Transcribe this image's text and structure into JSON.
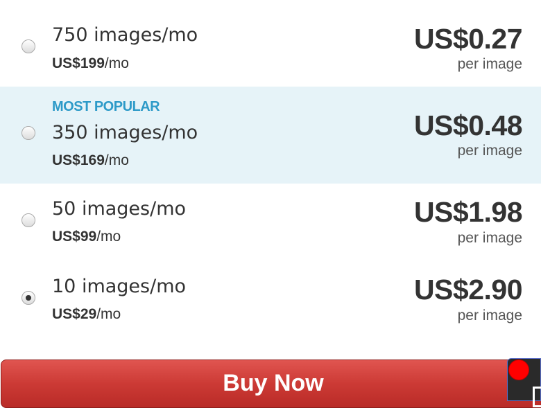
{
  "plans": [
    {
      "quantity": "750 images/mo",
      "monthly_price": "US$199",
      "monthly_suffix": "/mo",
      "unit_price": "US$0.27",
      "per_label": "per image",
      "selected": false
    },
    {
      "badge": "MOST POPULAR",
      "quantity": "350 images/mo",
      "monthly_price": "US$169",
      "monthly_suffix": "/mo",
      "unit_price": "US$0.48",
      "per_label": "per image",
      "selected": false
    },
    {
      "quantity": "50 images/mo",
      "monthly_price": "US$99",
      "monthly_suffix": "/mo",
      "unit_price": "US$1.98",
      "per_label": "per image",
      "selected": false
    },
    {
      "quantity": "10 images/mo",
      "monthly_price": "US$29",
      "monthly_suffix": "/mo",
      "unit_price": "US$2.90",
      "per_label": "per image",
      "selected": true
    }
  ],
  "buy_button": {
    "label": "Buy Now"
  },
  "colors": {
    "highlight_bg": "#e6f3f8",
    "badge": "#2d9ac8",
    "buy_button": "#cc3a35",
    "text": "#333333"
  },
  "icons": {
    "widget_dot": "record-dot-icon",
    "widget_square": "square-icon"
  }
}
